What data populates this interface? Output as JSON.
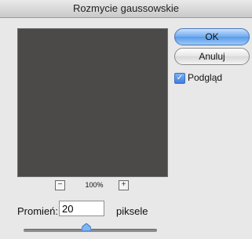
{
  "dialog": {
    "title": "Rozmycie gaussowskie",
    "ok_label": "OK",
    "cancel_label": "Anuluj",
    "preview_label": "Podgląd",
    "preview_checked": true
  },
  "zoom": {
    "level": "100%",
    "minus": "−",
    "plus": "+"
  },
  "radius": {
    "label": "Promień:",
    "value": "20",
    "unit": "piksele",
    "slider_fraction": 0.47
  },
  "colors": {
    "preview_bg": "#4b4a48",
    "ok_accent": "#6eaaf0"
  }
}
